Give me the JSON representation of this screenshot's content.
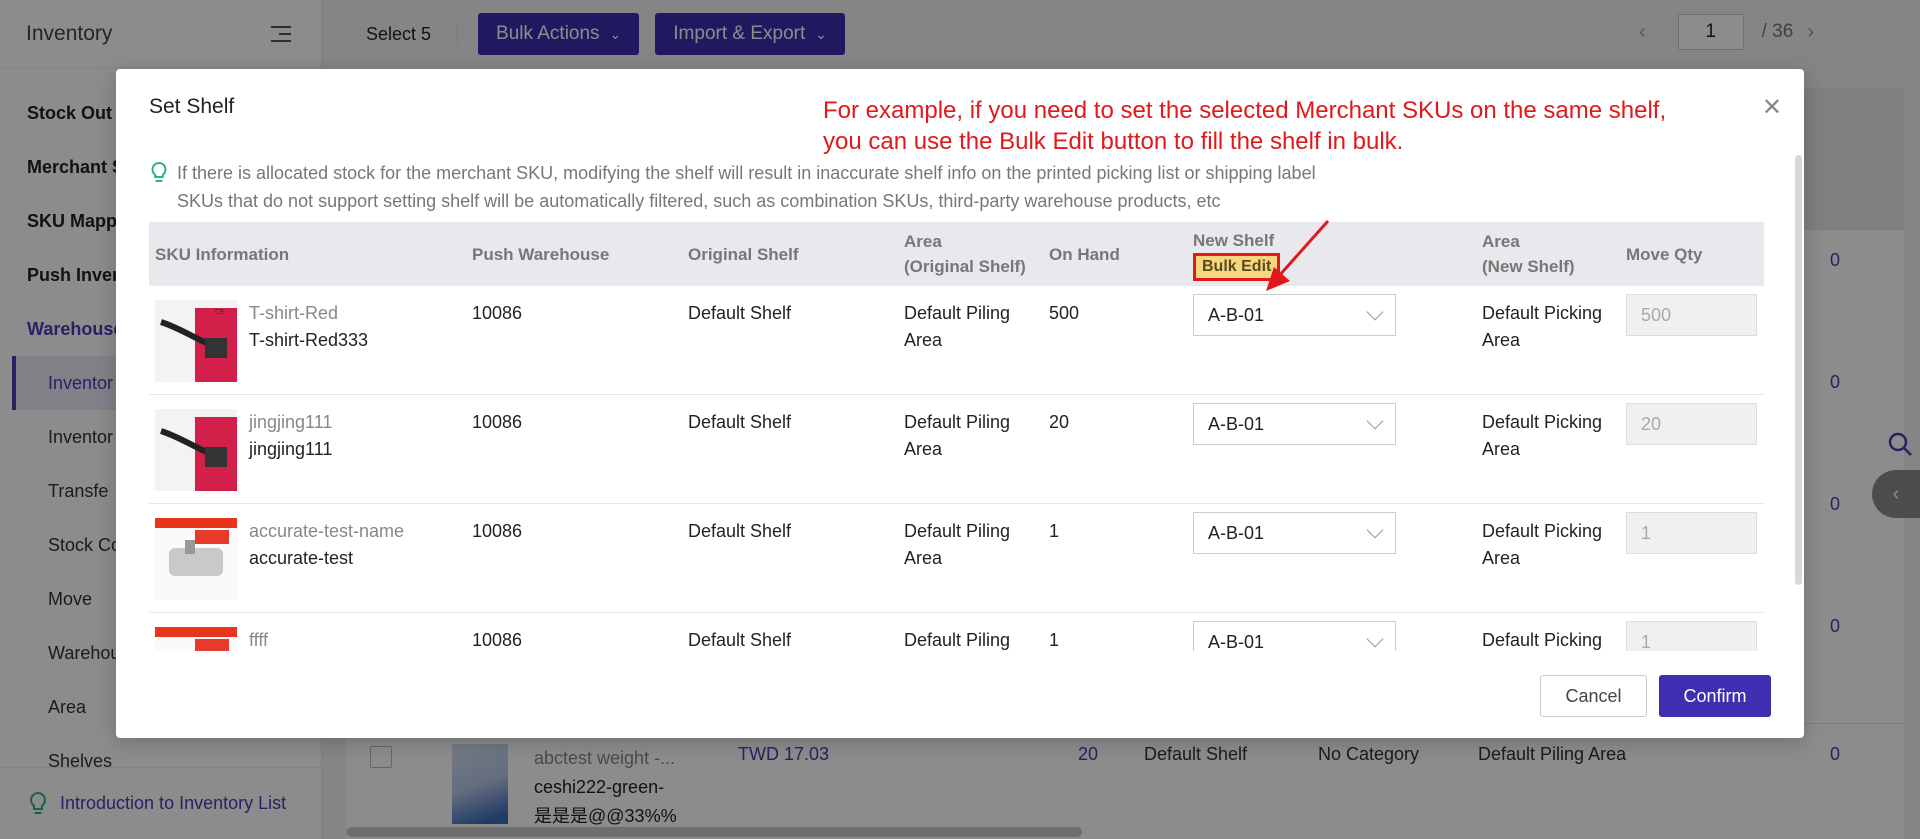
{
  "sidebar": {
    "title": "Inventory",
    "items": [
      {
        "label": "Stock Out /"
      },
      {
        "label": "Merchant S"
      },
      {
        "label": "SKU Mapp"
      },
      {
        "label": "Push Inven"
      }
    ],
    "group": "Warehouse",
    "subitems": [
      {
        "label": "Inventor"
      },
      {
        "label": "Inventor"
      },
      {
        "label": "Transfe"
      },
      {
        "label": "Stock Co"
      },
      {
        "label": "Move"
      },
      {
        "label": "Warehou"
      },
      {
        "label": "Area"
      },
      {
        "label": "Shelves"
      }
    ],
    "footer_link": "Introduction to Inventory List"
  },
  "topbar": {
    "select_count": "Select 5",
    "bulk_actions": "Bulk Actions",
    "import_export": "Import & Export",
    "page_current": "1",
    "page_total": "/ 36"
  },
  "background": {
    "zero_value": "0",
    "row": {
      "name": "abctest weight -...",
      "sku1": "ceshi222-green-",
      "sku2": "是是是@@33%%",
      "price": "TWD 17.03",
      "qty": "20",
      "shelf": "Default Shelf",
      "category": "No Category",
      "area": "Default Piling Area",
      "last": "0"
    }
  },
  "modal": {
    "title": "Set Shelf",
    "annotation_line1": "For example, if you need to set the selected Merchant SKUs on the same shelf,",
    "annotation_line2": "you can use the Bulk Edit button to fill the shelf in bulk.",
    "hint1": "If there is allocated stock for the merchant SKU, modifying the shelf will result in inaccurate shelf info on the printed picking list or shipping label",
    "hint2": "SKUs that do not support setting shelf will be automatically filtered, such as combination SKUs, third-party warehouse products, etc",
    "columns": {
      "sku_info": "SKU Information",
      "push_warehouse": "Push Warehouse",
      "original_shelf": "Original Shelf",
      "area_original_1": "Area",
      "area_original_2": "(Original Shelf)",
      "on_hand": "On Hand",
      "new_shelf": "New Shelf",
      "bulk_edit": "Bulk Edit",
      "area_new_1": "Area",
      "area_new_2": "(New Shelf)",
      "move_qty": "Move Qty"
    },
    "rows": [
      {
        "name": "T-shirt-Red",
        "sku": "T-shirt-Red333",
        "warehouse": "10086",
        "orig_shelf": "Default Shelf",
        "orig_area_1": "Default Piling",
        "orig_area_2": "Area",
        "on_hand": "500",
        "new_shelf": "A-B-01",
        "new_area_1": "Default Picking",
        "new_area_2": "Area",
        "move_qty": "500"
      },
      {
        "name": "jingjing111",
        "sku": "jingjing111",
        "warehouse": "10086",
        "orig_shelf": "Default Shelf",
        "orig_area_1": "Default Piling",
        "orig_area_2": "Area",
        "on_hand": "20",
        "new_shelf": "A-B-01",
        "new_area_1": "Default Picking",
        "new_area_2": "Area",
        "move_qty": "20"
      },
      {
        "name": "accurate-test-name",
        "sku": "accurate-test",
        "warehouse": "10086",
        "orig_shelf": "Default Shelf",
        "orig_area_1": "Default Piling",
        "orig_area_2": "Area",
        "on_hand": "1",
        "new_shelf": "A-B-01",
        "new_area_1": "Default Picking",
        "new_area_2": "Area",
        "move_qty": "1"
      },
      {
        "name": "ffff",
        "sku": "",
        "warehouse": "10086",
        "orig_shelf": "Default Shelf",
        "orig_area_1": "Default Piling",
        "orig_area_2": "",
        "on_hand": "1",
        "new_shelf": "A-B-01",
        "new_area_1": "Default Picking",
        "new_area_2": "",
        "move_qty": "1"
      }
    ],
    "cancel": "Cancel",
    "confirm": "Confirm"
  },
  "colors": {
    "primary": "#3d2fb0",
    "annotation": "#e0191c",
    "highlight": "#f6d77f"
  }
}
